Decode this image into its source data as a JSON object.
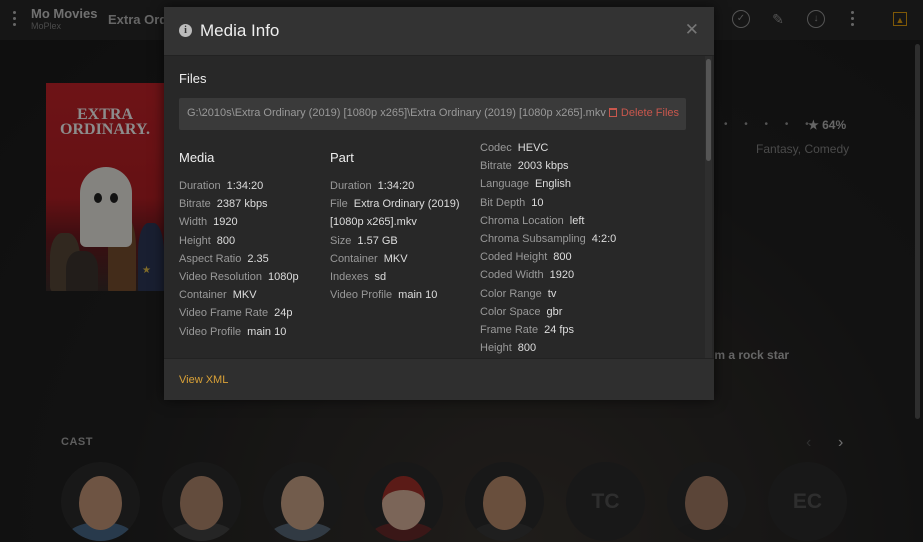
{
  "app": {
    "title": "Mo Movies",
    "subtitle": "MoPlex",
    "breadcrumb": "Extra Ordinary"
  },
  "toolbar": {
    "icons": [
      "check-circle-icon",
      "pencil-icon",
      "download-icon",
      "more-vertical-icon",
      "poster-icon"
    ]
  },
  "movie": {
    "poster_text": "EXTRA ORDINARY.",
    "rating": "64%",
    "genres": "Fantasy, Comedy",
    "tagline_fragment": "om a rock star"
  },
  "cast": {
    "label": "CAST",
    "members": [
      {
        "initials": ""
      },
      {
        "initials": ""
      },
      {
        "initials": ""
      },
      {
        "initials": ""
      },
      {
        "initials": ""
      },
      {
        "initials": "TC"
      },
      {
        "initials": ""
      },
      {
        "initials": "EC"
      }
    ]
  },
  "modal": {
    "title": "Media Info",
    "files_heading": "Files",
    "file_path": "G:\\2010s\\Extra Ordinary (2019) [1080p x265]\\Extra Ordinary (2019) [1080p x265].mkv",
    "delete_label": "Delete Files",
    "footer_link": "View XML",
    "media": {
      "heading": "Media",
      "rows": [
        {
          "k": "Duration",
          "v": "1:34:20"
        },
        {
          "k": "Bitrate",
          "v": "2387 kbps"
        },
        {
          "k": "Width",
          "v": "1920"
        },
        {
          "k": "Height",
          "v": "800"
        },
        {
          "k": "Aspect Ratio",
          "v": "2.35"
        },
        {
          "k": "Video Resolution",
          "v": "1080p"
        },
        {
          "k": "Container",
          "v": "MKV"
        },
        {
          "k": "Video Frame Rate",
          "v": "24p"
        },
        {
          "k": "Video Profile",
          "v": "main 10"
        }
      ]
    },
    "part": {
      "heading": "Part",
      "rows": [
        {
          "k": "Duration",
          "v": "1:34:20"
        },
        {
          "k": "File",
          "v": "Extra Ordinary (2019)"
        },
        {
          "k": "",
          "v": "[1080p x265].mkv"
        },
        {
          "k": "Size",
          "v": "1.57 GB"
        },
        {
          "k": "Container",
          "v": "MKV"
        },
        {
          "k": "Indexes",
          "v": "sd"
        },
        {
          "k": "Video Profile",
          "v": "main 10"
        }
      ]
    },
    "stream": {
      "rows": [
        {
          "k": "Codec",
          "v": "HEVC"
        },
        {
          "k": "Bitrate",
          "v": "2003 kbps"
        },
        {
          "k": "Language",
          "v": "English"
        },
        {
          "k": "Bit Depth",
          "v": "10"
        },
        {
          "k": "Chroma Location",
          "v": "left"
        },
        {
          "k": "Chroma Subsampling",
          "v": "4:2:0"
        },
        {
          "k": "Coded Height",
          "v": "800"
        },
        {
          "k": "Coded Width",
          "v": "1920"
        },
        {
          "k": "Color Range",
          "v": "tv"
        },
        {
          "k": "Color Space",
          "v": "gbr"
        },
        {
          "k": "Frame Rate",
          "v": "24 fps"
        },
        {
          "k": "Height",
          "v": "800"
        }
      ]
    }
  },
  "colors": {
    "accent": "#e5a00d",
    "delete": "#c9574d",
    "link": "#d9a137"
  }
}
